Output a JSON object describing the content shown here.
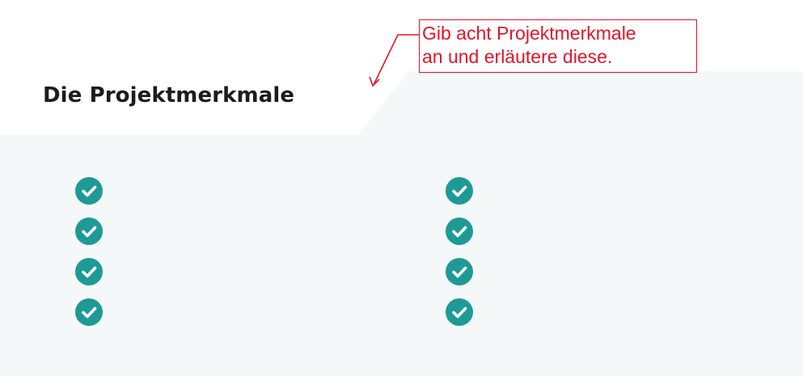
{
  "section": {
    "title": "Die Projektmerkmale"
  },
  "annotation": {
    "lines": [
      "Gib acht Projektmerkmale",
      "an und erläutere diese."
    ],
    "color": "#e3142a"
  },
  "features": {
    "left": [
      {
        "icon": "check-circle-icon",
        "text": ""
      },
      {
        "icon": "check-circle-icon",
        "text": ""
      },
      {
        "icon": "check-circle-icon",
        "text": ""
      },
      {
        "icon": "check-circle-icon",
        "text": ""
      }
    ],
    "right": [
      {
        "icon": "check-circle-icon",
        "text": ""
      },
      {
        "icon": "check-circle-icon",
        "text": ""
      },
      {
        "icon": "check-circle-icon",
        "text": ""
      },
      {
        "icon": "check-circle-icon",
        "text": ""
      }
    ]
  },
  "colors": {
    "panel_background": "#f4f8f8",
    "check_icon": "#1e9a96",
    "title_text": "#1c1c1c"
  }
}
